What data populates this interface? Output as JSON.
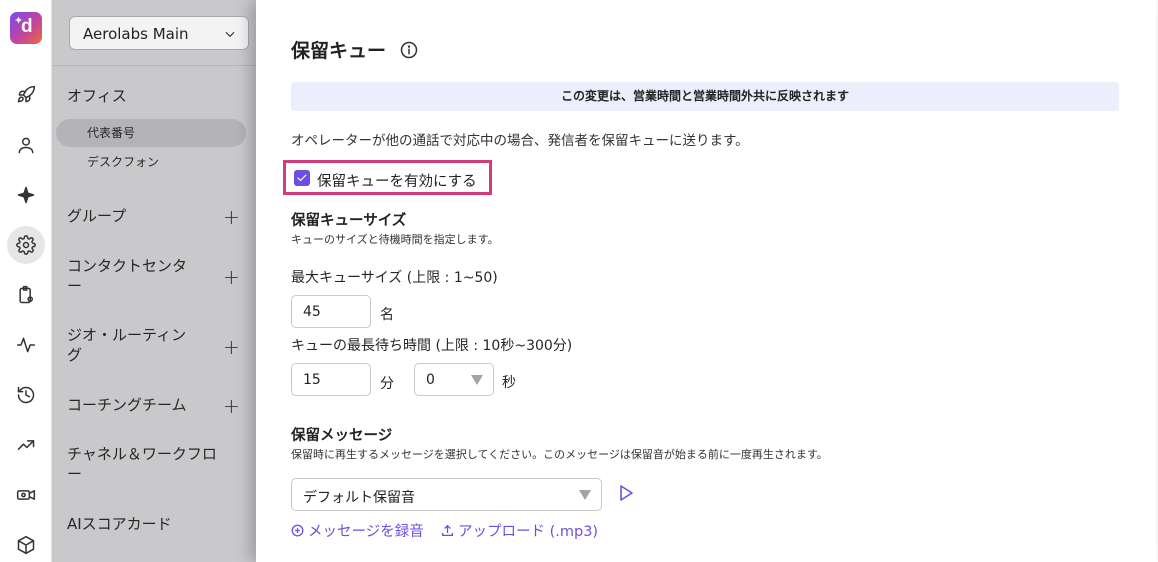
{
  "app": {
    "logo_letter": "d"
  },
  "rail": {
    "items": [
      {
        "icon": "rocket-icon"
      },
      {
        "icon": "user-icon"
      },
      {
        "icon": "sparkle-icon"
      },
      {
        "icon": "gear-icon",
        "active": true
      },
      {
        "icon": "clipboard-settings-icon"
      },
      {
        "icon": "activity-icon"
      },
      {
        "icon": "history-icon"
      },
      {
        "icon": "trending-up-icon"
      },
      {
        "icon": "video-settings-icon"
      },
      {
        "icon": "cube-icon"
      }
    ]
  },
  "sidebar": {
    "workspace": "Aerolabs Main",
    "office_label": "オフィス",
    "office_items": [
      "代表番号",
      "デスクフォン"
    ],
    "groups": [
      {
        "label": "グループ",
        "has_add": true
      },
      {
        "label_line1": "コンタクトセンタ",
        "label_line2": "ー",
        "has_add": true
      },
      {
        "label_line1": "ジオ・ルーティン",
        "label_line2": "グ",
        "has_add": true
      },
      {
        "label": "コーチングチーム",
        "has_add": true
      },
      {
        "label_line1": "チャネル＆ワークフロ",
        "label_line2": "ー",
        "has_add": false
      },
      {
        "label": "AIスコアカード",
        "has_add": false
      }
    ]
  },
  "main": {
    "title": "保留キュー",
    "banner": "この変更は、営業時間と営業時間外共に反映されます",
    "description": "オペレーターが他の通話で対応中の場合、発信者を保留キューに送ります。",
    "enable_label": "保留キューを有効にする",
    "enable_checked": true,
    "queue_size": {
      "heading": "保留キューサイズ",
      "subtext": "キューのサイズと待機時間を指定します。",
      "max_label": "最大キューサイズ (上限 : 1~50)",
      "max_value": "45",
      "max_unit": "名",
      "wait_label": "キューの最長待ち時間 (上限 : 10秒~300分)",
      "wait_minutes": "15",
      "minutes_unit": "分",
      "wait_seconds": "0",
      "seconds_unit": "秒"
    },
    "hold_message": {
      "heading": "保留メッセージ",
      "subtext": "保留時に再生するメッセージを選択してください。このメッセージは保留音が始まる前に一度再生されます。",
      "selected": "デフォルト保留音",
      "record_link": "メッセージを録音",
      "upload_link": "アップロード (.mp3)"
    }
  },
  "colors": {
    "accent": "#6e4ee0",
    "highlight_border": "#d23c7c",
    "banner_bg": "#eceefb",
    "sidebar_bg": "#c9c9cc"
  }
}
